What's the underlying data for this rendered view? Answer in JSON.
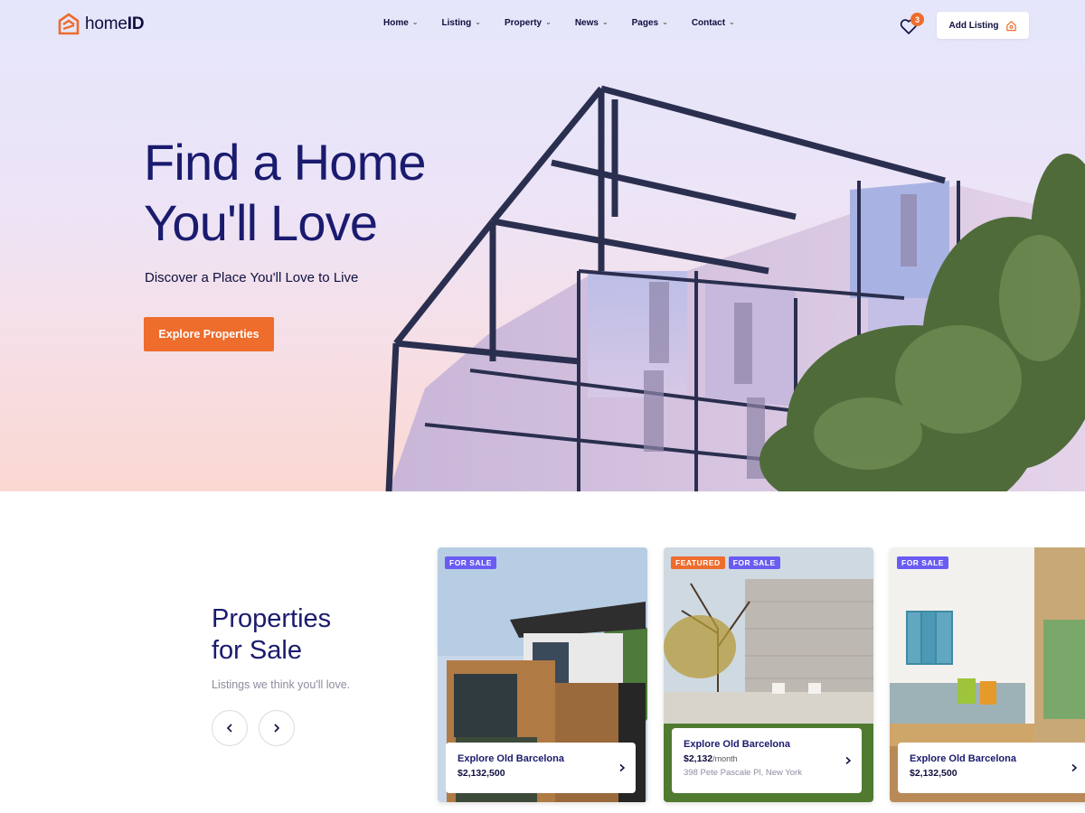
{
  "brand": {
    "name_light": "home",
    "name_bold": "ID",
    "color": "#ee6c2c"
  },
  "nav": {
    "items": [
      {
        "label": "Home"
      },
      {
        "label": "Listing"
      },
      {
        "label": "Property"
      },
      {
        "label": "News"
      },
      {
        "label": "Pages"
      },
      {
        "label": "Contact"
      }
    ]
  },
  "header": {
    "favorites_count": "3",
    "add_listing_label": "Add Listing"
  },
  "hero": {
    "title_line1": "Find a Home",
    "title_line2": "You'll Love",
    "subtitle": "Discover a Place You'll Love to Live",
    "cta_label": "Explore Properties"
  },
  "properties": {
    "title_line1": "Properties",
    "title_line2": "for Sale",
    "subtitle": "Listings we think you'll love.",
    "cards": [
      {
        "badges": [
          "FOR SALE"
        ],
        "title": "Explore Old Barcelona",
        "price": "$2,132,500",
        "price_suffix": "",
        "address": ""
      },
      {
        "badges": [
          "FEATURED",
          "FOR SALE"
        ],
        "title": "Explore Old Barcelona",
        "price": "$2,132",
        "price_suffix": "/month",
        "address": "398 Pete Pascale Pl, New York"
      },
      {
        "badges": [
          "FOR SALE"
        ],
        "title": "Explore Old Barcelona",
        "price": "$2,132,500",
        "price_suffix": "",
        "address": ""
      }
    ]
  },
  "colors": {
    "accent": "#ee6c2c",
    "primary_text": "#1a1b6e",
    "badge_sale": "#6a5cf2"
  },
  "icons": [
    "house-logo-icon",
    "chevron-down-icon",
    "heart-icon",
    "house-outline-icon",
    "arrow-left-icon",
    "arrow-right-icon",
    "chevron-right-icon"
  ]
}
